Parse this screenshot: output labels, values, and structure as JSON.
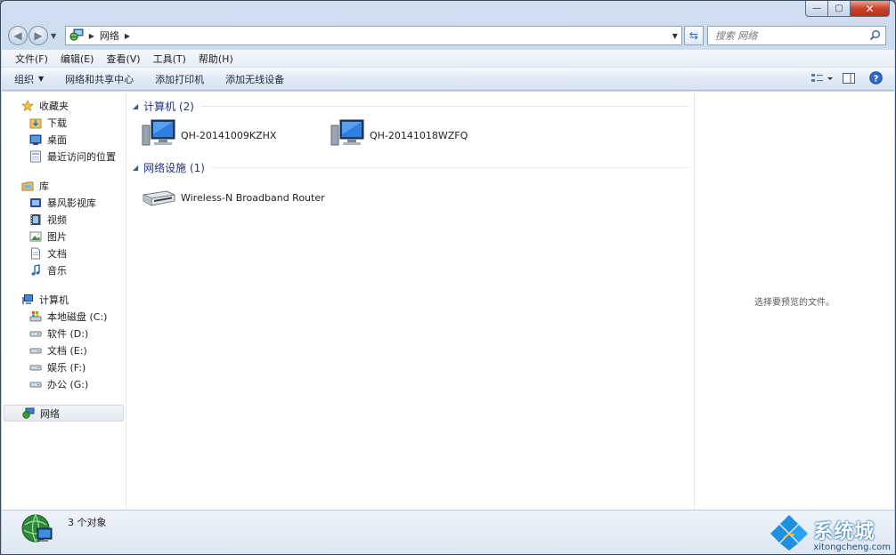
{
  "window": {
    "caption": {
      "minimize": "—",
      "maximize": "▢",
      "close": "✕"
    }
  },
  "address": {
    "back_icon": "back-arrow-icon",
    "forward_icon": "forward-arrow-icon",
    "path_icon": "network-icon",
    "path": "网络",
    "search_placeholder": "搜索 网络"
  },
  "menubar": {
    "items": [
      "文件(F)",
      "编辑(E)",
      "查看(V)",
      "工具(T)",
      "帮助(H)"
    ]
  },
  "cmdbar": {
    "items": [
      "组织",
      "网络和共享中心",
      "添加打印机",
      "添加无线设备"
    ]
  },
  "nav": {
    "favorites": {
      "label": "收藏夹",
      "items": [
        "下载",
        "桌面",
        "最近访问的位置"
      ]
    },
    "libraries": {
      "label": "库",
      "items": [
        "暴风影视库",
        "视频",
        "图片",
        "文档",
        "音乐"
      ]
    },
    "computer": {
      "label": "计算机",
      "items": [
        "本地磁盘 (C:)",
        "软件 (D:)",
        "文档 (E:)",
        "娱乐 (F:)",
        "办公 (G:)"
      ]
    },
    "network": {
      "label": "网络"
    }
  },
  "files": {
    "groups": [
      {
        "title": "计算机 (2)",
        "items": [
          "QH-20141009KZHX",
          "QH-20141018WZFQ"
        ]
      },
      {
        "title": "网络设施 (1)",
        "items": [
          "Wireless-N Broadband Router"
        ]
      }
    ]
  },
  "preview": {
    "text": "选择要预览的文件。"
  },
  "status": {
    "text": "3 个对象"
  },
  "watermark": {
    "title": "系统城",
    "subtitle": "xitongcheng.com"
  },
  "colors": {
    "accent": "#1e3287",
    "chrome": "#bcd1e8",
    "close": "#c9432a"
  }
}
